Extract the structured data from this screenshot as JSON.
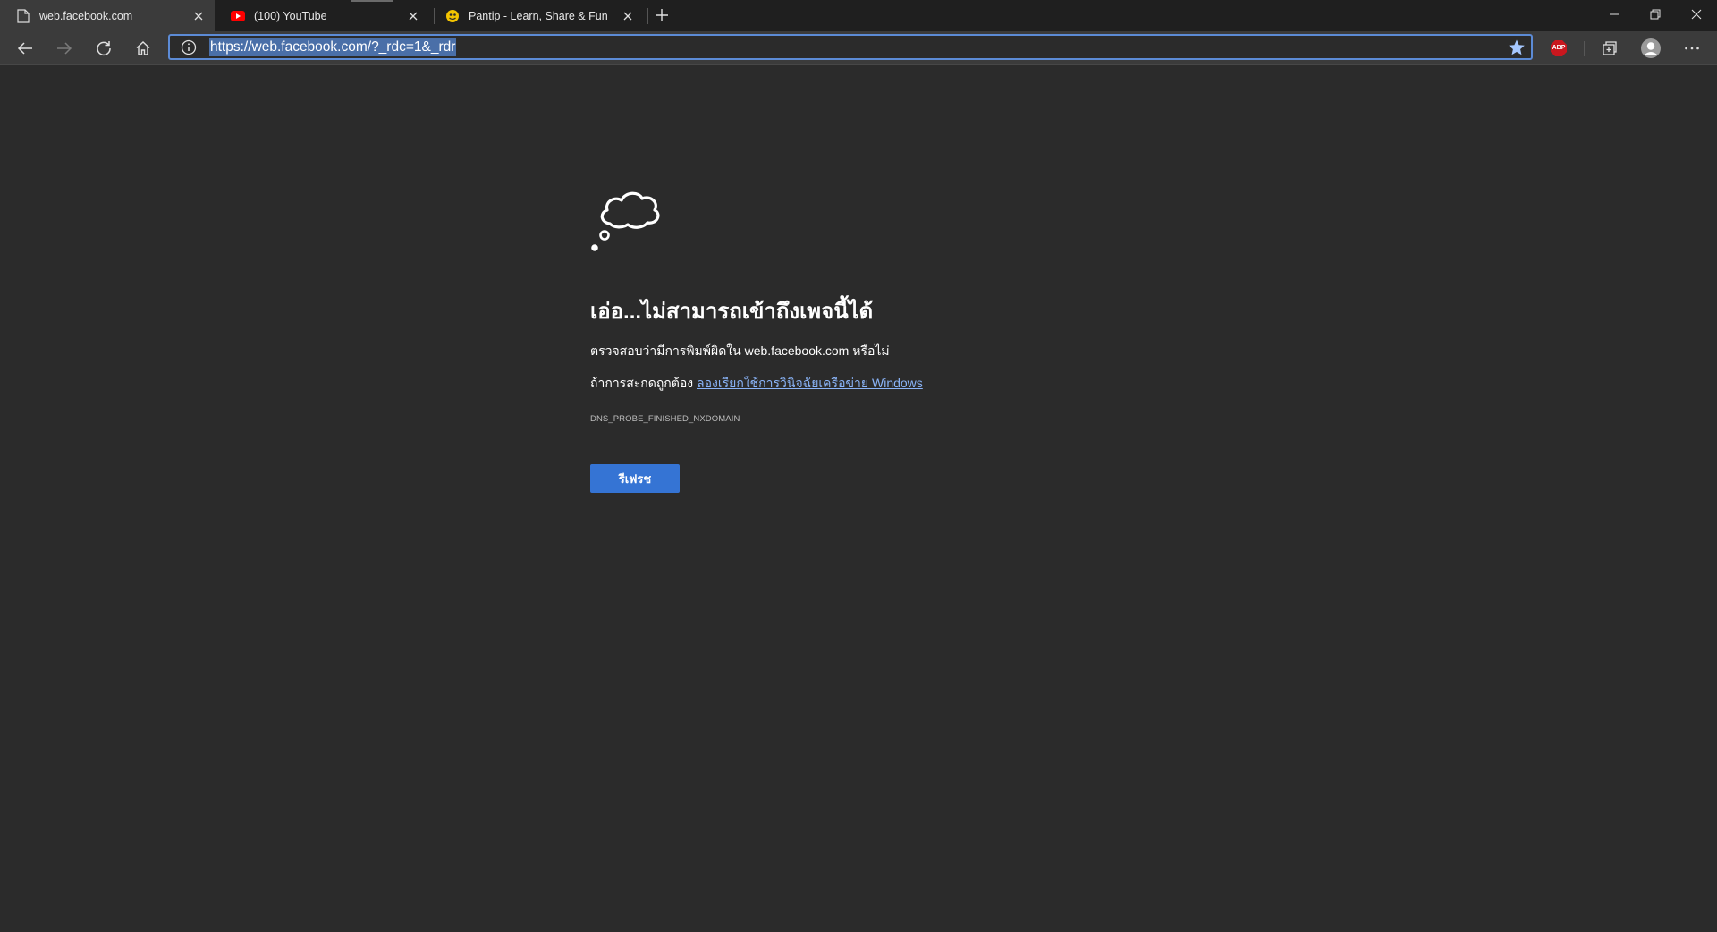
{
  "browser": {
    "tabs": [
      {
        "title": "web.facebook.com",
        "favicon": "page-icon",
        "active": true
      },
      {
        "title": "(100) YouTube",
        "favicon": "youtube-icon",
        "active": false
      },
      {
        "title": "Pantip - Learn, Share & Fun",
        "favicon": "pantip-icon",
        "active": false
      }
    ],
    "address_url": "https://web.facebook.com/?_rdc=1&_rdr",
    "extension_label": "ABP",
    "colors": {
      "accent": "#5c8bd6",
      "selection": "#4a6fa8",
      "youtube_red": "#ff0000",
      "abp_red": "#c9171e"
    }
  },
  "error": {
    "heading": "เอ่อ...ไม่สามารถเข้าถึงเพจนี้ได้",
    "line1": "ตรวจสอบว่ามีการพิมพ์ผิดใน web.facebook.com หรือไม่",
    "line2_prefix": "ถ้าการสะกดถูกต้อง ",
    "line2_link": "ลองเรียกใช้การวินิจฉัยเครือข่าย Windows",
    "code": "DNS_PROBE_FINISHED_NXDOMAIN",
    "refresh_label": "รีเฟรช",
    "colors": {
      "link": "#8ab4f8",
      "button": "#3574d4"
    }
  }
}
